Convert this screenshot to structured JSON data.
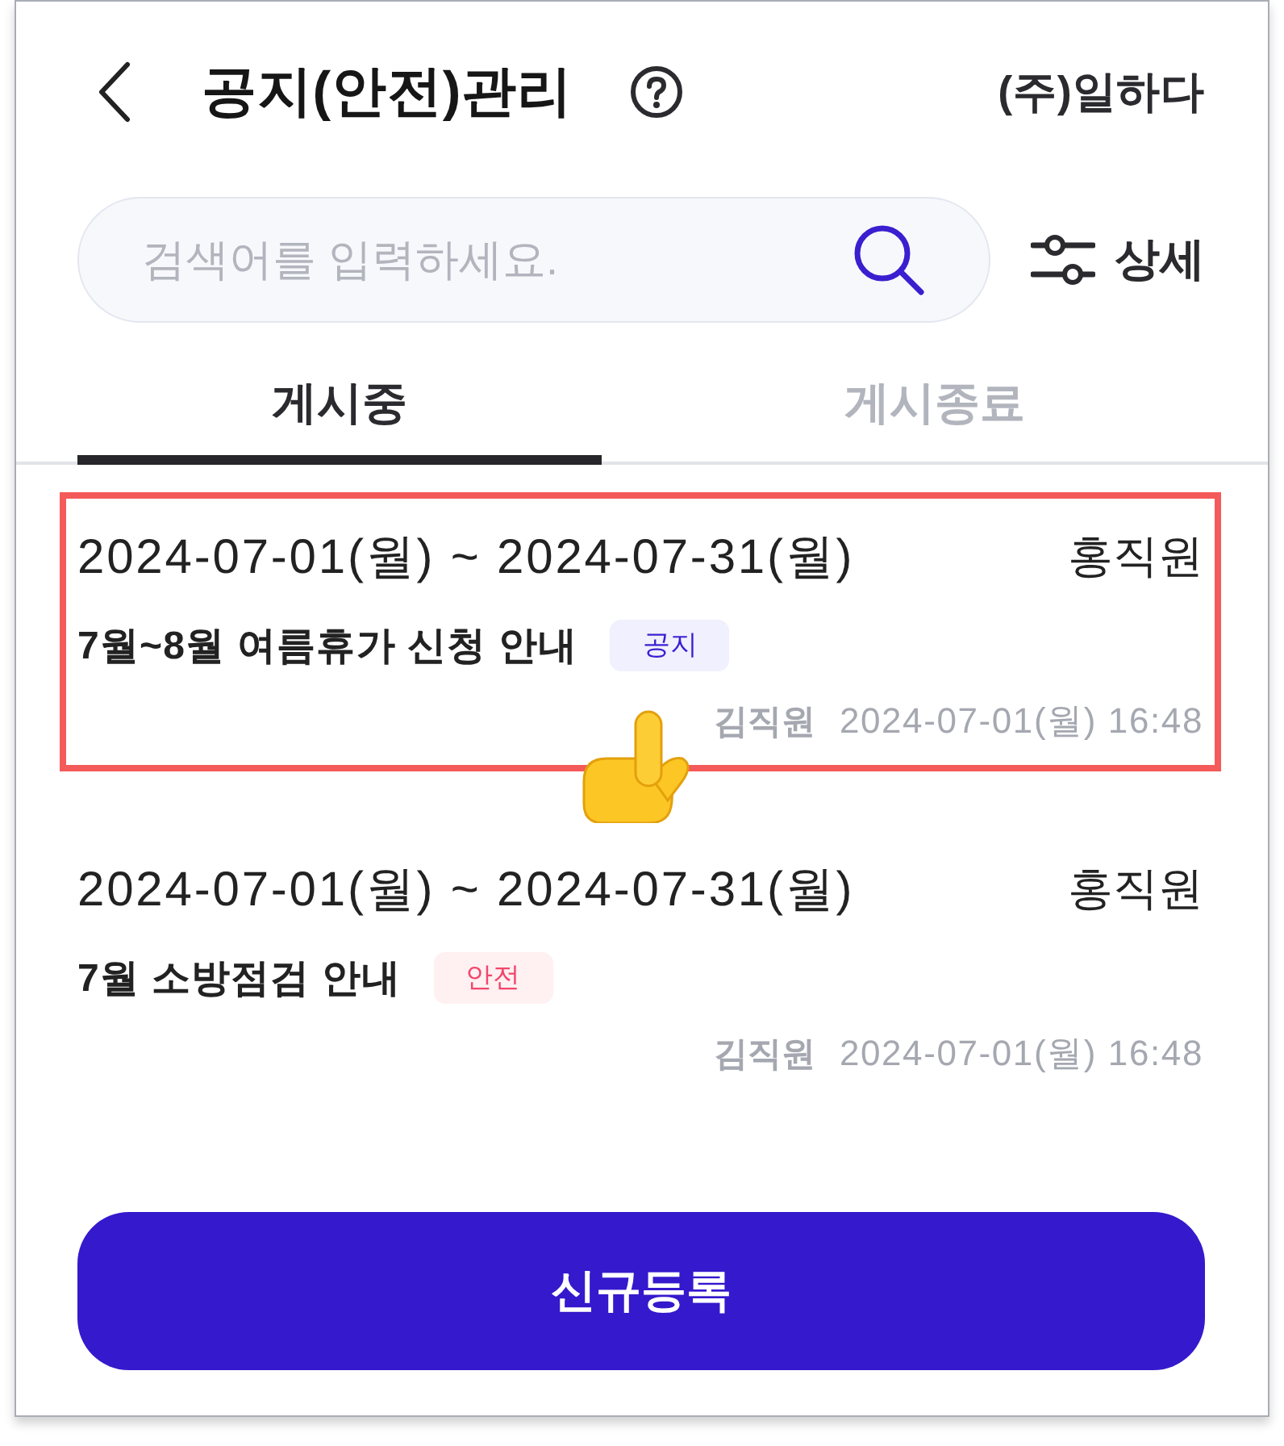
{
  "header": {
    "title": "공지(안전)관리",
    "company": "(주)일하다"
  },
  "search": {
    "placeholder": "검색어를 입력하세요.",
    "detail_label": "상세"
  },
  "tabs": [
    {
      "label": "게시중",
      "selected": true
    },
    {
      "label": "게시종료",
      "selected": false
    }
  ],
  "notices": [
    {
      "period": "2024-07-01(월) ~ 2024-07-31(월)",
      "assignee": "홍직원",
      "title": "7월~8월 여름휴가 신청 안내",
      "tag": {
        "label": "공지",
        "kind": "notice"
      },
      "author": "김직원",
      "posted": "2024-07-01(월) 16:48",
      "highlighted": true
    },
    {
      "period": "2024-07-01(월) ~ 2024-07-31(월)",
      "assignee": "홍직원",
      "title": "7월 소방점검 안내",
      "tag": {
        "label": "안전",
        "kind": "safety"
      },
      "author": "김직원",
      "posted": "2024-07-01(월) 16:48",
      "highlighted": false
    }
  ],
  "register_button": "신규등록"
}
